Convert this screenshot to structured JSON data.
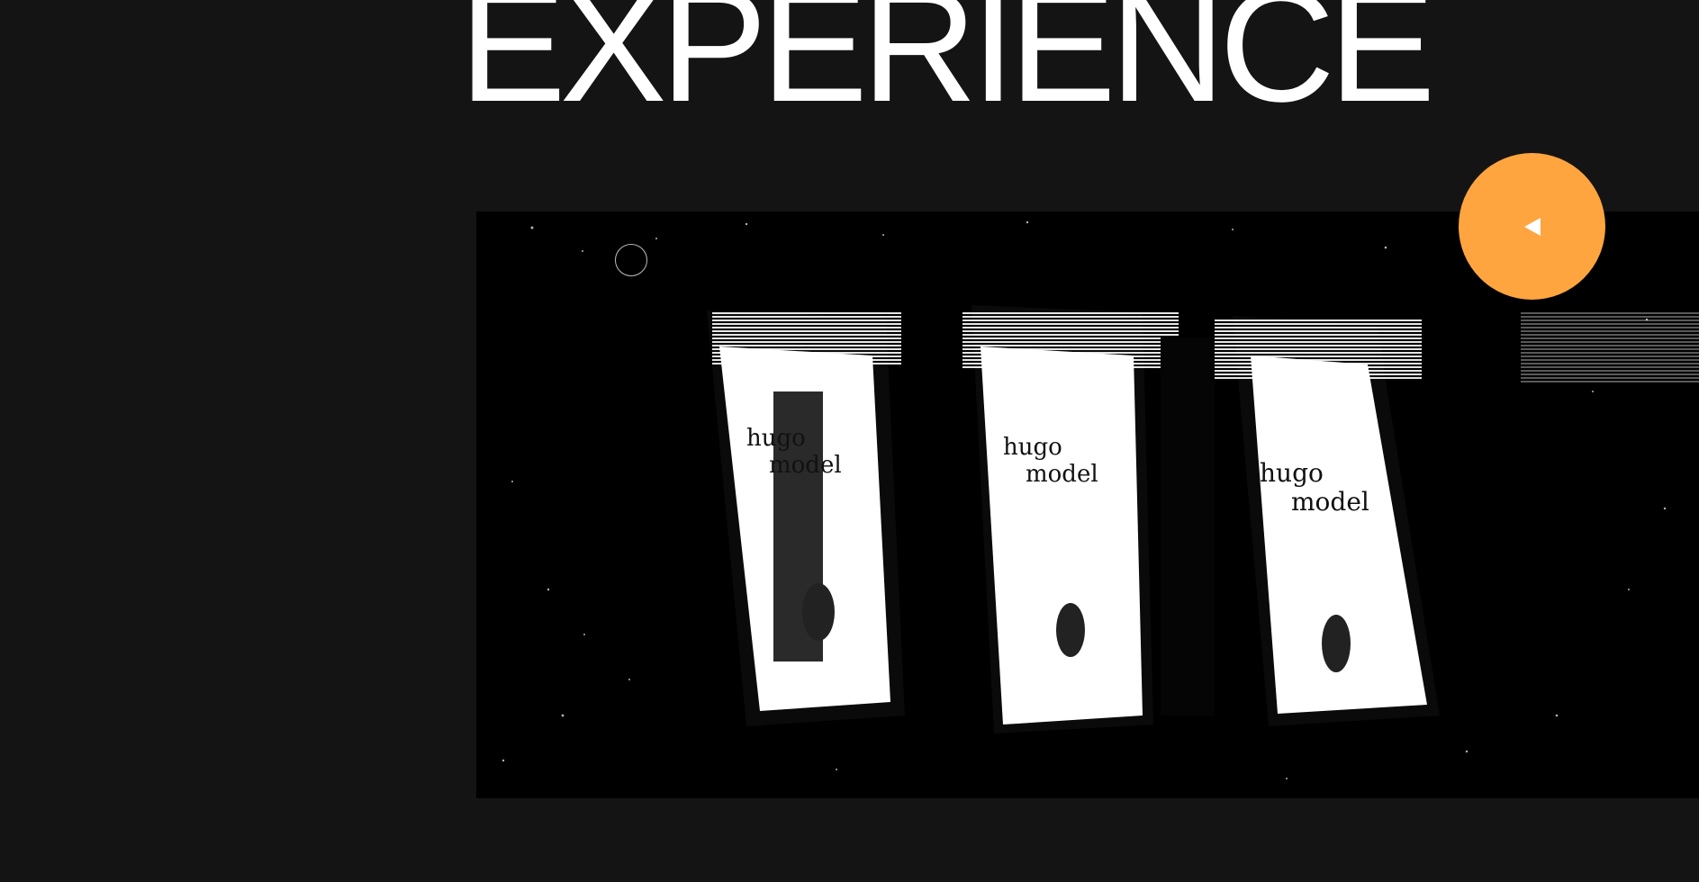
{
  "section": {
    "heading": "EXPERIENCE"
  },
  "video": {
    "phone_label_line1": "hugo",
    "phone_label_line2": "model"
  },
  "play_button": {
    "icon": "triangle-left-icon",
    "color": "#FFA53F"
  },
  "colors": {
    "page_background": "#141414",
    "video_background": "#000000",
    "heading": "#FFFFFF"
  }
}
